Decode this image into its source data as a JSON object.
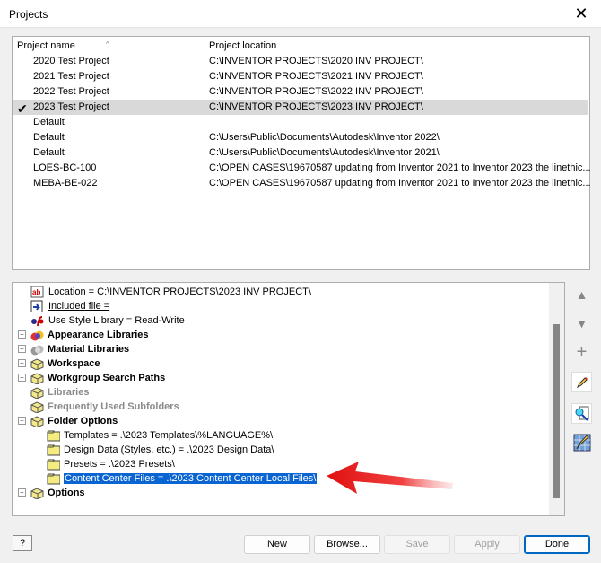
{
  "window": {
    "title": "Projects",
    "close": "✕"
  },
  "projects": {
    "headers": [
      "Project name",
      "Project location"
    ],
    "sort_arrow": "^",
    "check": "✔",
    "rows": [
      {
        "name": "2020 Test Project",
        "location": "C:\\INVENTOR PROJECTS\\2020 INV PROJECT\\"
      },
      {
        "name": "2021 Test Project",
        "location": "C:\\INVENTOR PROJECTS\\2021 INV PROJECT\\"
      },
      {
        "name": "2022 Test Project",
        "location": "C:\\INVENTOR PROJECTS\\2022 INV PROJECT\\"
      },
      {
        "name": "2023 Test Project",
        "location": "C:\\INVENTOR PROJECTS\\2023 INV PROJECT\\",
        "active": true
      },
      {
        "name": "Default",
        "location": ""
      },
      {
        "name": "Default",
        "location": "C:\\Users\\Public\\Documents\\Autodesk\\Inventor 2022\\"
      },
      {
        "name": "Default",
        "location": "C:\\Users\\Public\\Documents\\Autodesk\\Inventor 2021\\"
      },
      {
        "name": "LOES-BC-100",
        "location": "C:\\OPEN CASES\\19670587 updating from Inventor 2021 to Inventor 2023 the linethic..."
      },
      {
        "name": "MEBA-BE-022",
        "location": "C:\\OPEN CASES\\19670587 updating from Inventor 2021 to Inventor 2023 the linethic..."
      }
    ]
  },
  "tree": {
    "location": "Location = C:\\INVENTOR PROJECTS\\2023 INV PROJECT\\",
    "included": "Included file = ",
    "style": "Use Style Library = Read-Write",
    "appearance": "Appearance Libraries",
    "material": "Material Libraries",
    "workspace": "Workspace",
    "workgroup": "Workgroup Search Paths",
    "libraries": "Libraries",
    "frequent": "Frequently Used Subfolders",
    "folder_options": "Folder Options",
    "templates": "Templates = .\\2023 Templates\\%LANGUAGE%\\",
    "design_data": "Design Data (Styles, etc.) = .\\2023 Design Data\\",
    "presets": "Presets = .\\2023 Presets\\",
    "content_center": "Content Center Files = .\\2023 Content Center Local Files\\",
    "options": "Options",
    "plus": "+",
    "minus": "−"
  },
  "side_buttons": {
    "up": "▲",
    "down": "▼",
    "add": "+"
  },
  "buttons": {
    "help": "?",
    "new": "New",
    "browse": "Browse...",
    "save": "Save",
    "apply": "Apply",
    "done": "Done"
  },
  "colors": {
    "selection": "#0a64d2",
    "arrow": "#e01010"
  }
}
